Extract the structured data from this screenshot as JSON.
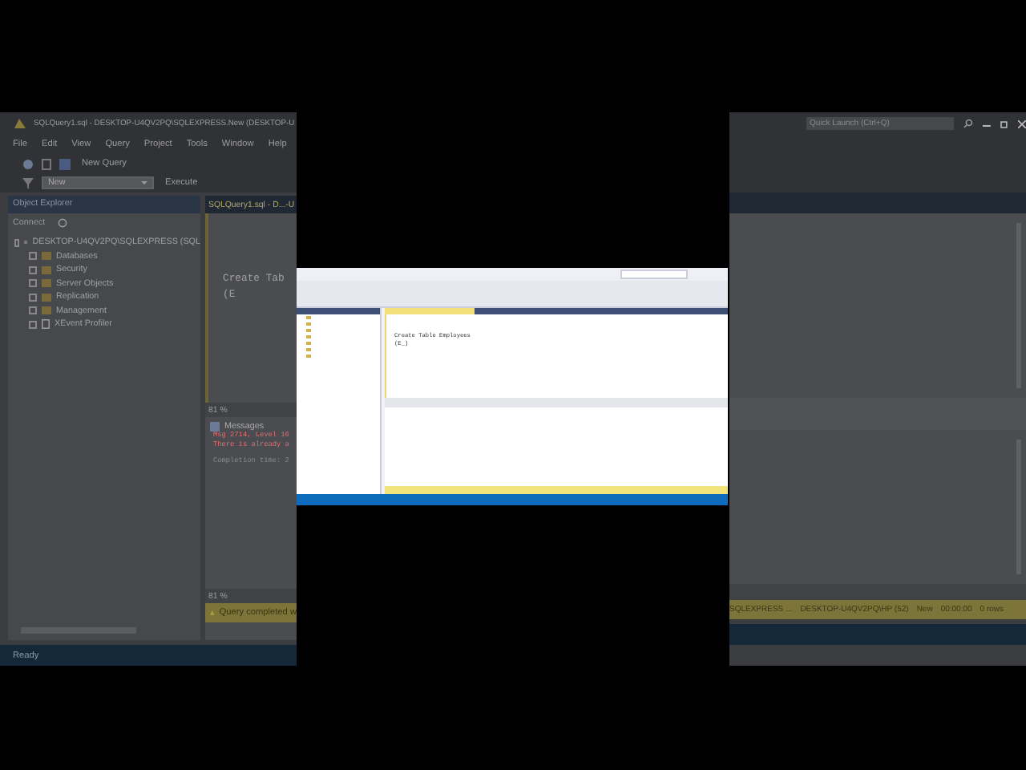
{
  "background_view": {
    "title": "SQLQuery1.sql - DESKTOP-U4QV2PQ\\SQLEXPRESS.New (DESKTOP-U",
    "menu": [
      "File",
      "Edit",
      "View",
      "Query",
      "Project",
      "Tools",
      "Window",
      "Help"
    ],
    "toolbar": {
      "new_query": "New Query",
      "database": "New",
      "execute": "Execute"
    },
    "quick_launch": {
      "placeholder": "Quick Launch (Ctrl+Q)"
    },
    "object_explorer": {
      "title": "Object Explorer",
      "connect": "Connect",
      "server": "DESKTOP-U4QV2PQ\\SQLEXPRESS (SQL",
      "nodes": [
        {
          "label": "Databases",
          "kind": "folder"
        },
        {
          "label": "Security",
          "kind": "folder"
        },
        {
          "label": "Server Objects",
          "kind": "folder"
        },
        {
          "label": "Replication",
          "kind": "folder"
        },
        {
          "label": "Management",
          "kind": "folder"
        },
        {
          "label": "XEvent Profiler",
          "kind": "profiler"
        }
      ]
    },
    "editor": {
      "tab": "SQLQuery1.sql - D...-U",
      "lines": [
        "Create Tab",
        "(E"
      ],
      "zoom": "81 %"
    },
    "messages": {
      "title": "Messages",
      "lines": [
        {
          "text": "Msg 2714, Level 16",
          "kind": "error"
        },
        {
          "text": "There is already a",
          "kind": "error"
        },
        {
          "text": "Completion time: 2",
          "kind": "info"
        }
      ]
    },
    "results_zoom": "81 %",
    "status": {
      "message": "Query completed w",
      "fields": [
        "SQLEXPRESS ...",
        "DESKTOP-U4QV2PQ\\HP (52)",
        "New",
        "00:00:00",
        "0 rows"
      ]
    },
    "statusbar": "Ready"
  },
  "center_view": {
    "editor_lines": [
      "Create Table Employees",
      "(E_)"
    ]
  }
}
